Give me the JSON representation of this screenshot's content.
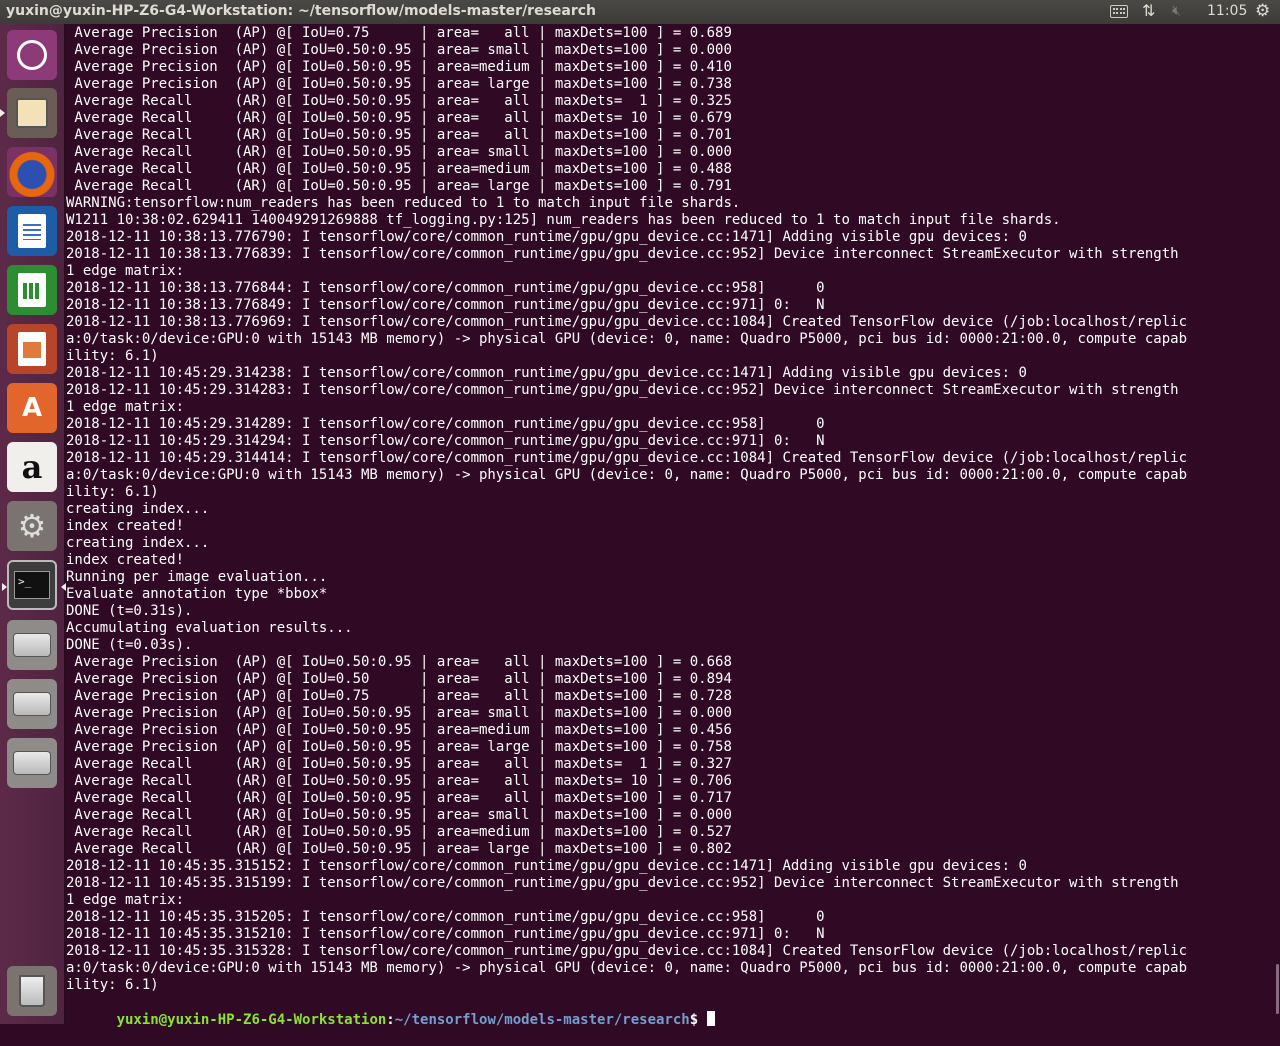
{
  "top_panel": {
    "title": "yuxin@yuxin-HP-Z6-G4-Workstation: ~/tensorflow/models-master/research",
    "clock": "11:05",
    "tray_icons": [
      "keyboard-icon",
      "network-icon",
      "volume-icon",
      "gear-icon"
    ]
  },
  "launcher": {
    "items": [
      {
        "name": "Ubuntu Dash",
        "icon": "ubuntu-logo-icon"
      },
      {
        "name": "Files",
        "icon": "file-cabinet-icon"
      },
      {
        "name": "Firefox",
        "icon": "firefox-icon"
      },
      {
        "name": "LibreOffice Writer",
        "icon": "writer-icon"
      },
      {
        "name": "LibreOffice Calc",
        "icon": "calc-icon"
      },
      {
        "name": "LibreOffice Impress",
        "icon": "impress-icon"
      },
      {
        "name": "Ubuntu Software",
        "icon": "shopping-bag-icon"
      },
      {
        "name": "Amazon",
        "icon": "amazon-icon"
      },
      {
        "name": "System Settings",
        "icon": "settings-icon"
      },
      {
        "name": "Terminal",
        "icon": "terminal-icon"
      },
      {
        "name": "Drive",
        "icon": "drive-icon"
      },
      {
        "name": "Drive",
        "icon": "drive-icon"
      },
      {
        "name": "Drive",
        "icon": "drive-icon"
      },
      {
        "name": "Trash",
        "icon": "trash-icon"
      }
    ]
  },
  "terminal": {
    "lines": [
      " Average Precision  (AP) @[ IoU=0.75      | area=   all | maxDets=100 ] = 0.689",
      " Average Precision  (AP) @[ IoU=0.50:0.95 | area= small | maxDets=100 ] = 0.000",
      " Average Precision  (AP) @[ IoU=0.50:0.95 | area=medium | maxDets=100 ] = 0.410",
      " Average Precision  (AP) @[ IoU=0.50:0.95 | area= large | maxDets=100 ] = 0.738",
      " Average Recall     (AR) @[ IoU=0.50:0.95 | area=   all | maxDets=  1 ] = 0.325",
      " Average Recall     (AR) @[ IoU=0.50:0.95 | area=   all | maxDets= 10 ] = 0.679",
      " Average Recall     (AR) @[ IoU=0.50:0.95 | area=   all | maxDets=100 ] = 0.701",
      " Average Recall     (AR) @[ IoU=0.50:0.95 | area= small | maxDets=100 ] = 0.000",
      " Average Recall     (AR) @[ IoU=0.50:0.95 | area=medium | maxDets=100 ] = 0.488",
      " Average Recall     (AR) @[ IoU=0.50:0.95 | area= large | maxDets=100 ] = 0.791",
      "WARNING:tensorflow:num_readers has been reduced to 1 to match input file shards.",
      "W1211 10:38:02.629411 140049291269888 tf_logging.py:125] num_readers has been reduced to 1 to match input file shards.",
      "2018-12-11 10:38:13.776790: I tensorflow/core/common_runtime/gpu/gpu_device.cc:1471] Adding visible gpu devices: 0",
      "2018-12-11 10:38:13.776839: I tensorflow/core/common_runtime/gpu/gpu_device.cc:952] Device interconnect StreamExecutor with strength",
      "1 edge matrix:",
      "2018-12-11 10:38:13.776844: I tensorflow/core/common_runtime/gpu/gpu_device.cc:958]      0",
      "2018-12-11 10:38:13.776849: I tensorflow/core/common_runtime/gpu/gpu_device.cc:971] 0:   N",
      "2018-12-11 10:38:13.776969: I tensorflow/core/common_runtime/gpu/gpu_device.cc:1084] Created TensorFlow device (/job:localhost/replic",
      "a:0/task:0/device:GPU:0 with 15143 MB memory) -> physical GPU (device: 0, name: Quadro P5000, pci bus id: 0000:21:00.0, compute capab",
      "ility: 6.1)",
      "2018-12-11 10:45:29.314238: I tensorflow/core/common_runtime/gpu/gpu_device.cc:1471] Adding visible gpu devices: 0",
      "2018-12-11 10:45:29.314283: I tensorflow/core/common_runtime/gpu/gpu_device.cc:952] Device interconnect StreamExecutor with strength",
      "1 edge matrix:",
      "2018-12-11 10:45:29.314289: I tensorflow/core/common_runtime/gpu/gpu_device.cc:958]      0",
      "2018-12-11 10:45:29.314294: I tensorflow/core/common_runtime/gpu/gpu_device.cc:971] 0:   N",
      "2018-12-11 10:45:29.314414: I tensorflow/core/common_runtime/gpu/gpu_device.cc:1084] Created TensorFlow device (/job:localhost/replic",
      "a:0/task:0/device:GPU:0 with 15143 MB memory) -> physical GPU (device: 0, name: Quadro P5000, pci bus id: 0000:21:00.0, compute capab",
      "ility: 6.1)",
      "creating index...",
      "index created!",
      "creating index...",
      "index created!",
      "Running per image evaluation...",
      "Evaluate annotation type *bbox*",
      "DONE (t=0.31s).",
      "Accumulating evaluation results...",
      "DONE (t=0.03s).",
      " Average Precision  (AP) @[ IoU=0.50:0.95 | area=   all | maxDets=100 ] = 0.668",
      " Average Precision  (AP) @[ IoU=0.50      | area=   all | maxDets=100 ] = 0.894",
      " Average Precision  (AP) @[ IoU=0.75      | area=   all | maxDets=100 ] = 0.728",
      " Average Precision  (AP) @[ IoU=0.50:0.95 | area= small | maxDets=100 ] = 0.000",
      " Average Precision  (AP) @[ IoU=0.50:0.95 | area=medium | maxDets=100 ] = 0.456",
      " Average Precision  (AP) @[ IoU=0.50:0.95 | area= large | maxDets=100 ] = 0.758",
      " Average Recall     (AR) @[ IoU=0.50:0.95 | area=   all | maxDets=  1 ] = 0.327",
      " Average Recall     (AR) @[ IoU=0.50:0.95 | area=   all | maxDets= 10 ] = 0.706",
      " Average Recall     (AR) @[ IoU=0.50:0.95 | area=   all | maxDets=100 ] = 0.717",
      " Average Recall     (AR) @[ IoU=0.50:0.95 | area= small | maxDets=100 ] = 0.000",
      " Average Recall     (AR) @[ IoU=0.50:0.95 | area=medium | maxDets=100 ] = 0.527",
      " Average Recall     (AR) @[ IoU=0.50:0.95 | area= large | maxDets=100 ] = 0.802",
      "2018-12-11 10:45:35.315152: I tensorflow/core/common_runtime/gpu/gpu_device.cc:1471] Adding visible gpu devices: 0",
      "2018-12-11 10:45:35.315199: I tensorflow/core/common_runtime/gpu/gpu_device.cc:952] Device interconnect StreamExecutor with strength",
      "1 edge matrix:",
      "2018-12-11 10:45:35.315205: I tensorflow/core/common_runtime/gpu/gpu_device.cc:958]      0",
      "2018-12-11 10:45:35.315210: I tensorflow/core/common_runtime/gpu/gpu_device.cc:971] 0:   N",
      "2018-12-11 10:45:35.315328: I tensorflow/core/common_runtime/gpu/gpu_device.cc:1084] Created TensorFlow device (/job:localhost/replic",
      "a:0/task:0/device:GPU:0 with 15143 MB memory) -> physical GPU (device: 0, name: Quadro P5000, pci bus id: 0000:21:00.0, compute capab",
      "ility: 6.1)"
    ],
    "prompt": {
      "user_host": "yuxin@yuxin-HP-Z6-G4-Workstation",
      "colon": ":",
      "path": "~/tensorflow/models-master/research",
      "dollar": "$ "
    }
  },
  "colors": {
    "terminal_bg": "#300a24",
    "prompt_user": "#8ae234",
    "prompt_path": "#729fcf",
    "panel_bg": "#3c3b37"
  }
}
